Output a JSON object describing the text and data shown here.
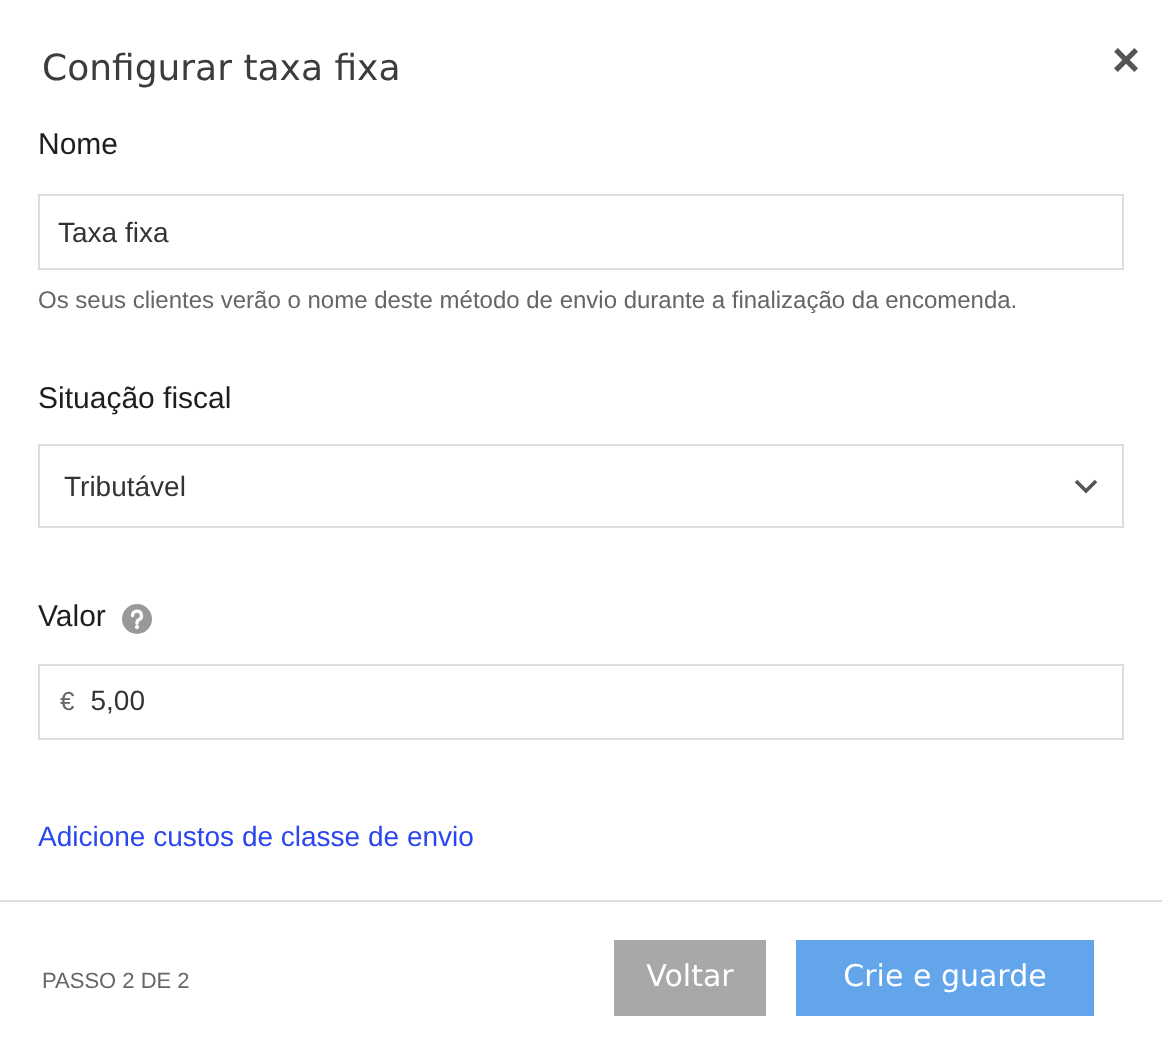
{
  "dialog": {
    "title": "Configurar taxa fixa",
    "close": "×"
  },
  "fields": [
    {
      "kind": "text",
      "label": "Nome",
      "value": "Taxa fixa",
      "help": "Os seus clientes verão o nome deste método de envio durante a finalização da encomenda."
    },
    {
      "kind": "select",
      "label": "Situação fiscal",
      "value": "Tributável"
    },
    {
      "kind": "money",
      "label": "Valor",
      "info": true,
      "prefix": "€",
      "value": "5,00"
    }
  ],
  "link": "Adicione custos de classe de envio",
  "footer": {
    "step": "PASSO 2 DE 2",
    "buttons": [
      {
        "label": "Voltar",
        "kind": "secondary"
      },
      {
        "label": "Crie e guarde",
        "kind": "primary"
      }
    ]
  }
}
